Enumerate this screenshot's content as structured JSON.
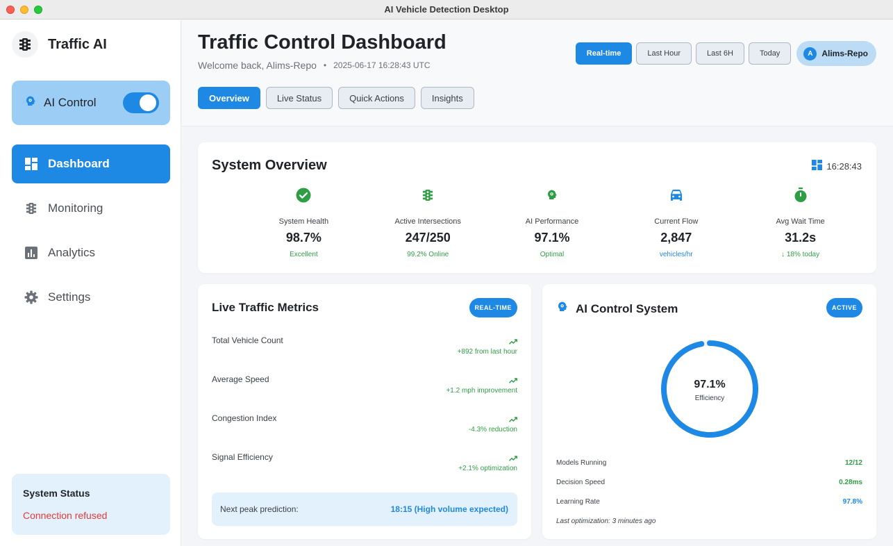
{
  "window": {
    "title": "AI Vehicle Detection Desktop"
  },
  "sidebar": {
    "brand": "Traffic AI",
    "ai_control": {
      "label": "AI Control",
      "enabled": true
    },
    "items": [
      {
        "label": "Dashboard",
        "icon": "dashboard-icon",
        "active": true
      },
      {
        "label": "Monitoring",
        "icon": "traffic-light-icon",
        "active": false
      },
      {
        "label": "Analytics",
        "icon": "bar-chart-icon",
        "active": false
      },
      {
        "label": "Settings",
        "icon": "gear-icon",
        "active": false
      }
    ],
    "status": {
      "title": "System Status",
      "message": "Connection refused"
    }
  },
  "header": {
    "title": "Traffic Control Dashboard",
    "welcome": "Welcome back, Alims-Repo",
    "separator": "•",
    "timestamp": "2025-06-17 16:28:43 UTC",
    "ranges": [
      "Real-time",
      "Last Hour",
      "Last 6H",
      "Today"
    ],
    "active_range": "Real-time",
    "user": {
      "initial": "A",
      "name": "Alims-Repo"
    },
    "tabs": [
      "Overview",
      "Live Status",
      "Quick Actions",
      "Insights"
    ],
    "active_tab": "Overview"
  },
  "overview": {
    "title": "System Overview",
    "time": "16:28:43",
    "stats": [
      {
        "label": "System Health",
        "value": "98.7%",
        "sub": "Excellent",
        "icon": "check-circle-icon",
        "color": "#2e9e44"
      },
      {
        "label": "Active Intersections",
        "value": "247/250",
        "sub": "99.2% Online",
        "icon": "traffic-light-icon",
        "color": "#2e9e44"
      },
      {
        "label": "AI Performance",
        "value": "97.1%",
        "sub": "Optimal",
        "icon": "ai-brain-icon",
        "color": "#2e9e44"
      },
      {
        "label": "Current Flow",
        "value": "2,847",
        "sub": "vehicles/hr",
        "icon": "car-icon",
        "color": "#1e88e5"
      },
      {
        "label": "Avg Wait Time",
        "value": "31.2s",
        "sub": "↓ 18% today",
        "icon": "timer-icon",
        "color": "#2e9e44"
      }
    ]
  },
  "metrics": {
    "title": "Live Traffic Metrics",
    "badge": "REAL-TIME",
    "rows": [
      {
        "name": "Total Vehicle Count",
        "change": "+892 from last hour"
      },
      {
        "name": "Average Speed",
        "change": "+1.2 mph improvement"
      },
      {
        "name": "Congestion Index",
        "change": "-4.3% reduction"
      },
      {
        "name": "Signal Efficiency",
        "change": "+2.1% optimization"
      }
    ],
    "peak": {
      "label": "Next peak prediction:",
      "value": "18:15 (High volume expected)"
    }
  },
  "ai_system": {
    "title": "AI Control System",
    "badge": "ACTIVE",
    "efficiency": {
      "value": "97.1%",
      "label": "Efficiency",
      "fraction": 0.971
    },
    "rows": [
      {
        "k": "Models Running",
        "v": "12/12",
        "color": "#2e9e44"
      },
      {
        "k": "Decision Speed",
        "v": "0.28ms",
        "color": "#2e9e44"
      },
      {
        "k": "Learning Rate",
        "v": "97.8%",
        "color": "#1e88e5"
      }
    ],
    "last_optimization": "Last optimization: 3 minutes ago"
  },
  "colors": {
    "accent": "#1e88e5",
    "success": "#2e9e44",
    "error": "#e53935"
  }
}
